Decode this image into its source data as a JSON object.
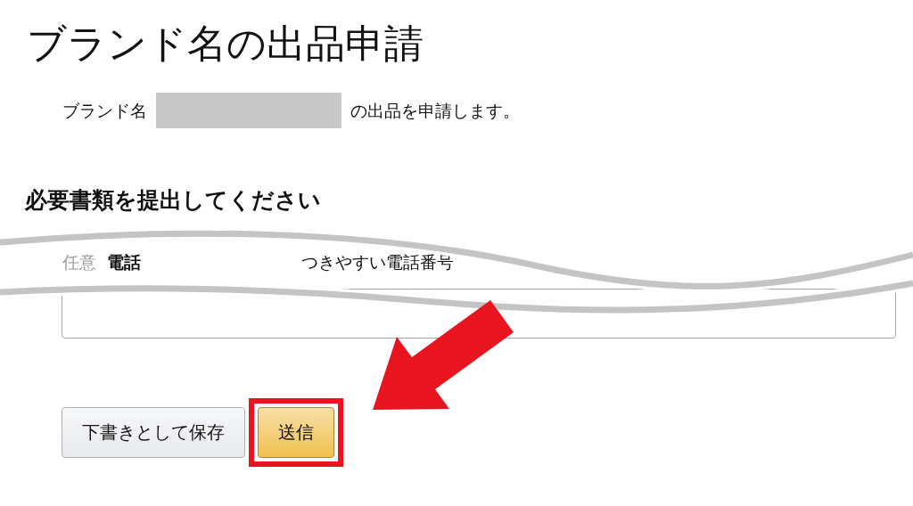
{
  "page": {
    "title": "ブランド名の出品申請",
    "intro": {
      "before": "ブランド名",
      "after": "の出品を申請します。"
    },
    "section_heading": "必要書類を提出してください",
    "phone_label": [
      {
        "text": "任意",
        "kind": "optional"
      },
      {
        "text": "電話",
        "kind": "bold"
      },
      {
        "text": "つきやすい電話番号",
        "kind": "plain"
      }
    ],
    "buttons": [
      {
        "label": "下書きとして保存",
        "kind": "secondary",
        "highlighted": false
      },
      {
        "label": "送信",
        "kind": "primary",
        "highlighted": true
      }
    ]
  }
}
